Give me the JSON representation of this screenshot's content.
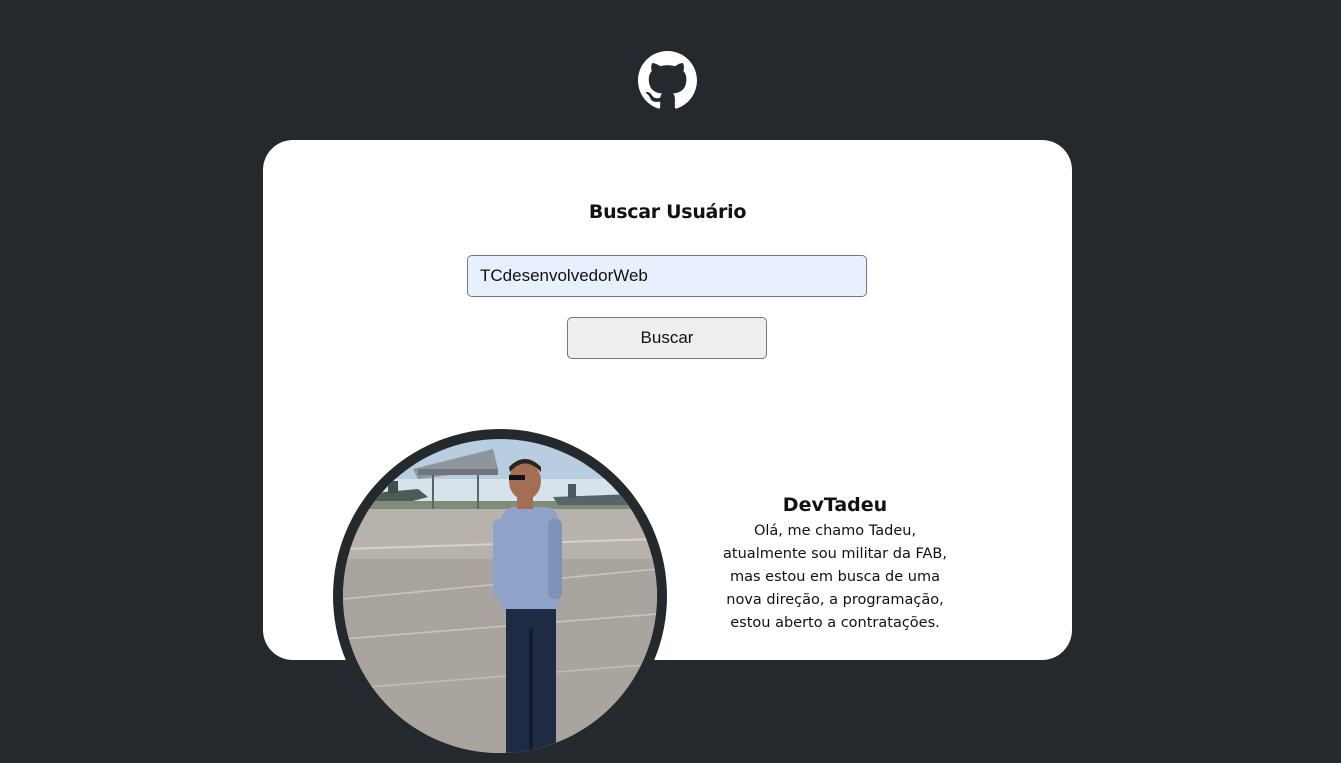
{
  "header": {
    "logo_icon": "github-icon"
  },
  "search": {
    "title": "Buscar Usuário",
    "input_value": "TCdesenvolvedorWeb",
    "button_label": "Buscar"
  },
  "profile": {
    "name": "DevTadeu",
    "bio": "Olá, me chamo Tadeu, atualmente sou militar da FAB, mas estou em busca de uma nova direção, a programação, estou aberto a contratações.",
    "avatar_ring_color": "#24292e"
  },
  "colors": {
    "background": "#24292e",
    "card": "#ffffff",
    "input_autofill": "#e8f0fe"
  }
}
